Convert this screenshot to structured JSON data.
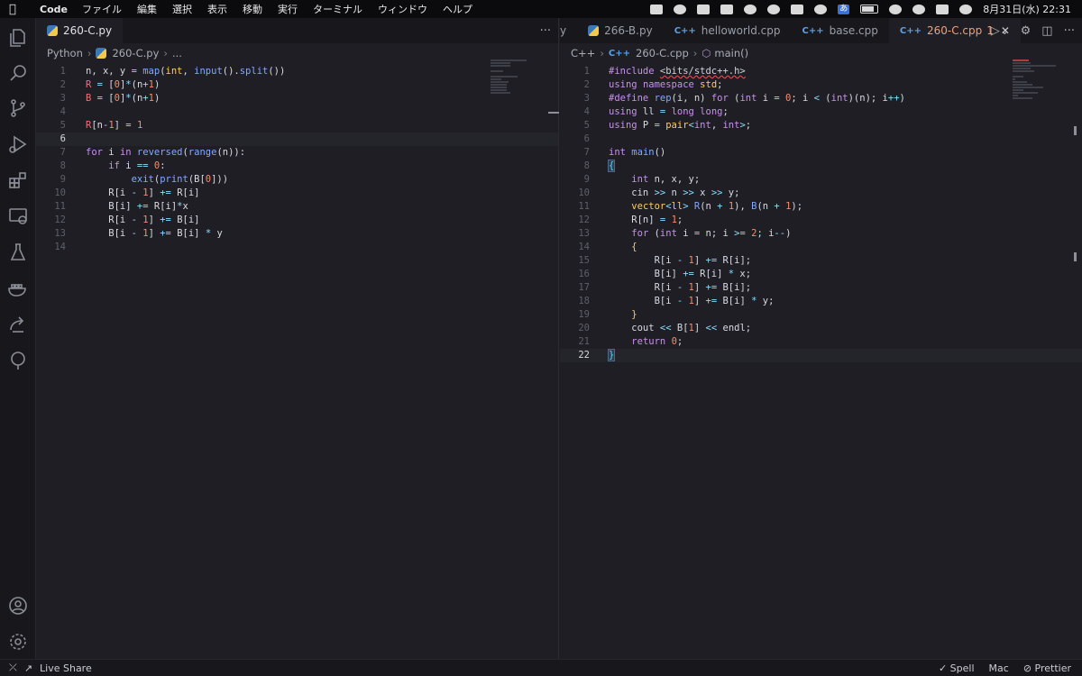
{
  "menubar": {
    "app_name": "Code",
    "items": [
      "ファイル",
      "編集",
      "選択",
      "表示",
      "移動",
      "実行",
      "ターミナル",
      "ウィンドウ",
      "ヘルプ"
    ],
    "input_method": "あ",
    "clock": "8月31日(水)  22:31"
  },
  "left_editor": {
    "tabs": [
      {
        "label": "260-C.py",
        "icon": "python-file-icon",
        "active": true
      }
    ],
    "breadcrumb": [
      "Python",
      "260-C.py",
      "..."
    ],
    "current_line": 6,
    "lines": [
      {
        "n": "1",
        "tokens": [
          [
            "id",
            "n, x, y "
          ],
          [
            "op",
            "="
          ],
          [
            "id",
            " "
          ],
          [
            "fn",
            "map"
          ],
          [
            "pu",
            "("
          ],
          [
            "ty",
            "int"
          ],
          [
            "pu",
            ", "
          ],
          [
            "fn",
            "input"
          ],
          [
            "pu",
            "()."
          ],
          [
            "fn",
            "split"
          ],
          [
            "pu",
            "())"
          ]
        ]
      },
      {
        "n": "2",
        "tokens": [
          [
            "var",
            "R"
          ],
          [
            "id",
            " "
          ],
          [
            "op",
            "="
          ],
          [
            "id",
            " ["
          ],
          [
            "num",
            "0"
          ],
          [
            "pu",
            "]"
          ],
          [
            "op",
            "*"
          ],
          [
            "pu",
            "(n"
          ],
          [
            "op",
            "+"
          ],
          [
            "num",
            "1"
          ],
          [
            "pu",
            ")"
          ]
        ]
      },
      {
        "n": "3",
        "tokens": [
          [
            "var",
            "B"
          ],
          [
            "id",
            " "
          ],
          [
            "op",
            "="
          ],
          [
            "id",
            " ["
          ],
          [
            "num",
            "0"
          ],
          [
            "pu",
            "]"
          ],
          [
            "op",
            "*"
          ],
          [
            "pu",
            "(n"
          ],
          [
            "op",
            "+"
          ],
          [
            "num",
            "1"
          ],
          [
            "pu",
            ")"
          ]
        ]
      },
      {
        "n": "4",
        "tokens": []
      },
      {
        "n": "5",
        "tokens": [
          [
            "var",
            "R"
          ],
          [
            "pu",
            "[n"
          ],
          [
            "op",
            "-"
          ],
          [
            "num",
            "1"
          ],
          [
            "pu",
            "] "
          ],
          [
            "op",
            "="
          ],
          [
            "id",
            " "
          ],
          [
            "num",
            "1"
          ]
        ]
      },
      {
        "n": "6",
        "tokens": []
      },
      {
        "n": "7",
        "tokens": [
          [
            "kw",
            "for"
          ],
          [
            "id",
            " i "
          ],
          [
            "kw",
            "in"
          ],
          [
            "id",
            " "
          ],
          [
            "fn",
            "reversed"
          ],
          [
            "pu",
            "("
          ],
          [
            "fn",
            "range"
          ],
          [
            "pu",
            "(n)):"
          ]
        ]
      },
      {
        "n": "8",
        "tokens": [
          [
            "id",
            "    "
          ],
          [
            "kw",
            "if"
          ],
          [
            "id",
            " i "
          ],
          [
            "op",
            "=="
          ],
          [
            "id",
            " "
          ],
          [
            "num",
            "0"
          ],
          [
            "pu",
            ":"
          ]
        ]
      },
      {
        "n": "9",
        "tokens": [
          [
            "id",
            "        "
          ],
          [
            "fn",
            "exit"
          ],
          [
            "pu",
            "("
          ],
          [
            "fn",
            "print"
          ],
          [
            "pu",
            "(B["
          ],
          [
            "num",
            "0"
          ],
          [
            "pu",
            "]))"
          ]
        ]
      },
      {
        "n": "10",
        "tokens": [
          [
            "id",
            "    R[i "
          ],
          [
            "op",
            "-"
          ],
          [
            "id",
            " "
          ],
          [
            "num",
            "1"
          ],
          [
            "pu",
            "] "
          ],
          [
            "op",
            "+="
          ],
          [
            "id",
            " R[i]"
          ]
        ]
      },
      {
        "n": "11",
        "tokens": [
          [
            "id",
            "    B[i] "
          ],
          [
            "op",
            "+="
          ],
          [
            "id",
            " R[i]"
          ],
          [
            "op",
            "*"
          ],
          [
            "id",
            "x"
          ]
        ]
      },
      {
        "n": "12",
        "tokens": [
          [
            "id",
            "    R[i "
          ],
          [
            "op",
            "-"
          ],
          [
            "id",
            " "
          ],
          [
            "num",
            "1"
          ],
          [
            "pu",
            "] "
          ],
          [
            "op",
            "+="
          ],
          [
            "id",
            " B[i]"
          ]
        ]
      },
      {
        "n": "13",
        "tokens": [
          [
            "id",
            "    B[i "
          ],
          [
            "op",
            "-"
          ],
          [
            "id",
            " "
          ],
          [
            "num",
            "1"
          ],
          [
            "pu",
            "] "
          ],
          [
            "op",
            "+="
          ],
          [
            "id",
            " B[i] "
          ],
          [
            "op",
            "*"
          ],
          [
            "id",
            " y"
          ]
        ]
      },
      {
        "n": "14",
        "tokens": []
      }
    ]
  },
  "right_editor": {
    "tabs": [
      {
        "label": "y",
        "icon": "",
        "active": false
      },
      {
        "label": "266-B.py",
        "icon": "python-file-icon",
        "active": false
      },
      {
        "label": "helloworld.cpp",
        "icon": "cpp-file-icon",
        "active": false
      },
      {
        "label": "base.cpp",
        "icon": "cpp-file-icon",
        "active": false
      },
      {
        "label": "260-C.cpp",
        "icon": "cpp-file-icon",
        "active": true,
        "badge": "1"
      }
    ],
    "breadcrumb": [
      "C++",
      "260-C.cpp",
      "main()"
    ],
    "current_line": 22,
    "lines": [
      {
        "n": "1",
        "tokens": [
          [
            "pp",
            "#include "
          ],
          [
            "squig",
            "<bits/stdc++.h>"
          ]
        ]
      },
      {
        "n": "2",
        "tokens": [
          [
            "kw",
            "using"
          ],
          [
            "id",
            " "
          ],
          [
            "kw",
            "namespace"
          ],
          [
            "id",
            " "
          ],
          [
            "ty",
            "std"
          ],
          [
            "pu",
            ";"
          ]
        ]
      },
      {
        "n": "3",
        "tokens": [
          [
            "pp",
            "#define "
          ],
          [
            "fn",
            "rep"
          ],
          [
            "pu",
            "(i, n) "
          ],
          [
            "kw",
            "for"
          ],
          [
            "pu",
            " ("
          ],
          [
            "kw",
            "int"
          ],
          [
            "id",
            " i "
          ],
          [
            "op",
            "="
          ],
          [
            "id",
            " "
          ],
          [
            "num",
            "0"
          ],
          [
            "pu",
            "; i "
          ],
          [
            "op",
            "<"
          ],
          [
            "pu",
            " ("
          ],
          [
            "kw",
            "int"
          ],
          [
            "pu",
            ")(n); i"
          ],
          [
            "op",
            "++"
          ],
          [
            "pu",
            ")"
          ]
        ]
      },
      {
        "n": "4",
        "tokens": [
          [
            "kw",
            "using"
          ],
          [
            "id",
            " ll "
          ],
          [
            "op",
            "="
          ],
          [
            "id",
            " "
          ],
          [
            "kw",
            "long long"
          ],
          [
            "pu",
            ";"
          ]
        ]
      },
      {
        "n": "5",
        "tokens": [
          [
            "kw",
            "using"
          ],
          [
            "id",
            " P "
          ],
          [
            "op",
            "="
          ],
          [
            "id",
            " "
          ],
          [
            "ty",
            "pair"
          ],
          [
            "op",
            "<"
          ],
          [
            "kw",
            "int"
          ],
          [
            "pu",
            ", "
          ],
          [
            "kw",
            "int"
          ],
          [
            "op",
            ">"
          ],
          [
            "pu",
            ";"
          ]
        ]
      },
      {
        "n": "6",
        "tokens": []
      },
      {
        "n": "7",
        "tokens": [
          [
            "kw",
            "int"
          ],
          [
            "id",
            " "
          ],
          [
            "fn",
            "main"
          ],
          [
            "pu",
            "()"
          ]
        ]
      },
      {
        "n": "8",
        "tokens": [
          [
            "br",
            "{"
          ]
        ]
      },
      {
        "n": "9",
        "tokens": [
          [
            "id",
            "    "
          ],
          [
            "kw",
            "int"
          ],
          [
            "id",
            " n, x, y;"
          ]
        ]
      },
      {
        "n": "10",
        "tokens": [
          [
            "id",
            "    cin "
          ],
          [
            "op",
            ">>"
          ],
          [
            "id",
            " n "
          ],
          [
            "op",
            ">>"
          ],
          [
            "id",
            " x "
          ],
          [
            "op",
            ">>"
          ],
          [
            "id",
            " y;"
          ]
        ]
      },
      {
        "n": "11",
        "tokens": [
          [
            "id",
            "    "
          ],
          [
            "ty",
            "vector"
          ],
          [
            "op",
            "<"
          ],
          [
            "ty",
            "ll"
          ],
          [
            "op",
            ">"
          ],
          [
            "id",
            " "
          ],
          [
            "fn",
            "R"
          ],
          [
            "pu",
            "(n "
          ],
          [
            "op",
            "+"
          ],
          [
            "id",
            " "
          ],
          [
            "num",
            "1"
          ],
          [
            "pu",
            "), "
          ],
          [
            "fn",
            "B"
          ],
          [
            "pu",
            "(n "
          ],
          [
            "op",
            "+"
          ],
          [
            "id",
            " "
          ],
          [
            "num",
            "1"
          ],
          [
            "pu",
            ");"
          ]
        ]
      },
      {
        "n": "12",
        "tokens": [
          [
            "id",
            "    R[n] "
          ],
          [
            "op",
            "="
          ],
          [
            "id",
            " "
          ],
          [
            "num",
            "1"
          ],
          [
            "pu",
            ";"
          ]
        ]
      },
      {
        "n": "13",
        "tokens": [
          [
            "id",
            "    "
          ],
          [
            "kw",
            "for"
          ],
          [
            "pu",
            " ("
          ],
          [
            "kw",
            "int"
          ],
          [
            "id",
            " i "
          ],
          [
            "op",
            "="
          ],
          [
            "id",
            " n; i "
          ],
          [
            "op",
            ">="
          ],
          [
            "id",
            " "
          ],
          [
            "num",
            "2"
          ],
          [
            "pu",
            "; i"
          ],
          [
            "op",
            "--"
          ],
          [
            "pu",
            ")"
          ]
        ]
      },
      {
        "n": "14",
        "tokens": [
          [
            "id",
            "    "
          ],
          [
            "ty",
            "{"
          ]
        ]
      },
      {
        "n": "15",
        "tokens": [
          [
            "id",
            "        R[i "
          ],
          [
            "op",
            "-"
          ],
          [
            "id",
            " "
          ],
          [
            "num",
            "1"
          ],
          [
            "pu",
            "] "
          ],
          [
            "op",
            "+="
          ],
          [
            "id",
            " R[i];"
          ]
        ]
      },
      {
        "n": "16",
        "tokens": [
          [
            "id",
            "        B[i] "
          ],
          [
            "op",
            "+="
          ],
          [
            "id",
            " R[i] "
          ],
          [
            "op",
            "*"
          ],
          [
            "id",
            " x;"
          ]
        ]
      },
      {
        "n": "17",
        "tokens": [
          [
            "id",
            "        R[i "
          ],
          [
            "op",
            "-"
          ],
          [
            "id",
            " "
          ],
          [
            "num",
            "1"
          ],
          [
            "pu",
            "] "
          ],
          [
            "op",
            "+="
          ],
          [
            "id",
            " B[i];"
          ]
        ]
      },
      {
        "n": "18",
        "tokens": [
          [
            "id",
            "        B[i "
          ],
          [
            "op",
            "-"
          ],
          [
            "id",
            " "
          ],
          [
            "num",
            "1"
          ],
          [
            "pu",
            "] "
          ],
          [
            "op",
            "+="
          ],
          [
            "id",
            " B[i] "
          ],
          [
            "op",
            "*"
          ],
          [
            "id",
            " y;"
          ]
        ]
      },
      {
        "n": "19",
        "tokens": [
          [
            "id",
            "    "
          ],
          [
            "ty",
            "}"
          ]
        ]
      },
      {
        "n": "20",
        "tokens": [
          [
            "id",
            "    cout "
          ],
          [
            "op",
            "<<"
          ],
          [
            "id",
            " B["
          ],
          [
            "num",
            "1"
          ],
          [
            "pu",
            "] "
          ],
          [
            "op",
            "<<"
          ],
          [
            "id",
            " endl;"
          ]
        ]
      },
      {
        "n": "21",
        "tokens": [
          [
            "id",
            "    "
          ],
          [
            "kw",
            "return"
          ],
          [
            "id",
            " "
          ],
          [
            "num",
            "0"
          ],
          [
            "pu",
            ";"
          ]
        ]
      },
      {
        "n": "22",
        "tokens": [
          [
            "br",
            "}"
          ]
        ]
      }
    ]
  },
  "statusbar": {
    "live_share": "Live Share",
    "spell": "Spell",
    "eol": "Mac",
    "prettier": "Prettier"
  },
  "colors": {
    "background": "#1e1e24",
    "keyword": "#c792ea",
    "function": "#82aaff",
    "number": "#f78c6c",
    "operator": "#89ddff",
    "type": "#ffcb6b",
    "variable": "#f07178"
  }
}
